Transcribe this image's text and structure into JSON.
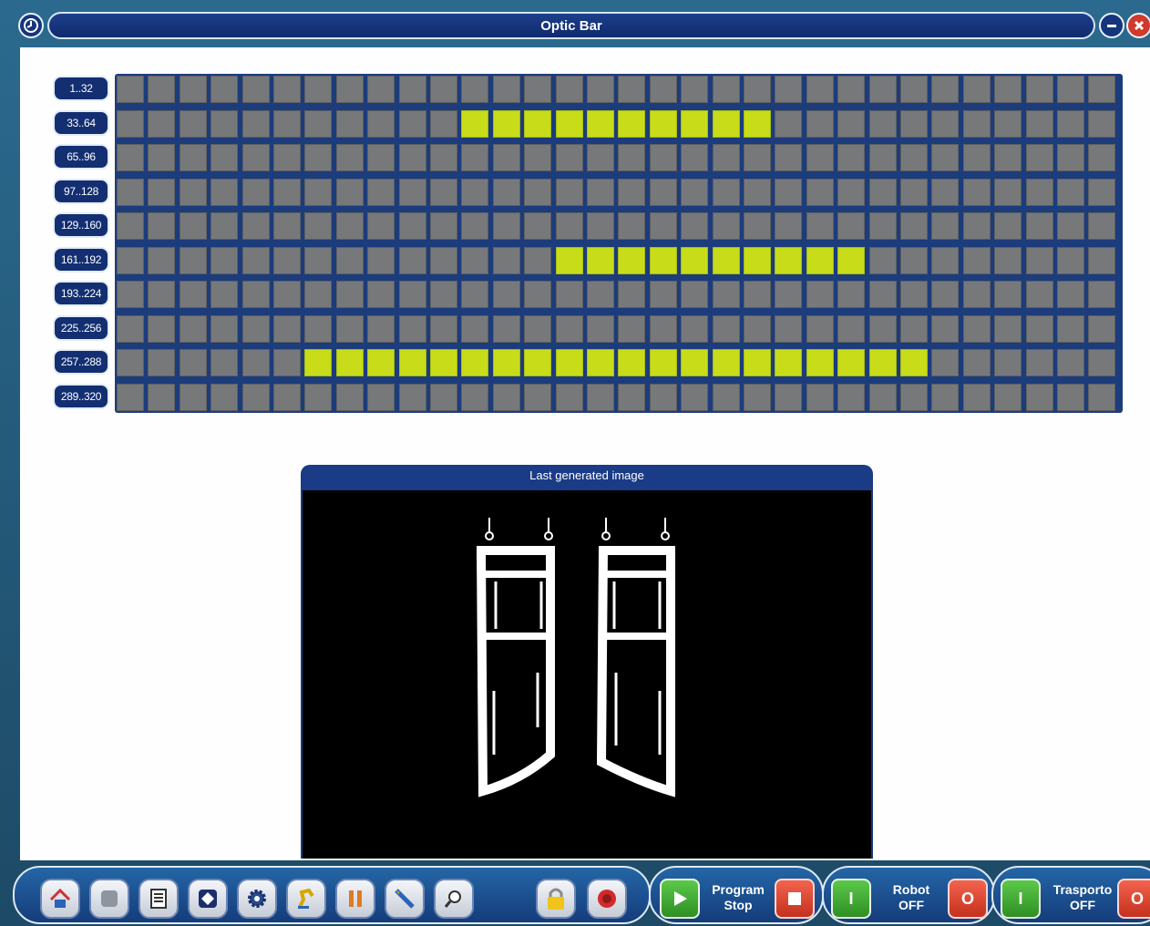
{
  "window": {
    "title": "Optic Bar"
  },
  "optic_bar": {
    "rows": [
      {
        "label": "1..32",
        "active": []
      },
      {
        "label": "33..64",
        "active": [
          11,
          12,
          13,
          14,
          15,
          16,
          17,
          18,
          19,
          20
        ]
      },
      {
        "label": "65..96",
        "active": []
      },
      {
        "label": "97..128",
        "active": []
      },
      {
        "label": "129..160",
        "active": []
      },
      {
        "label": "161..192",
        "active": [
          14,
          15,
          16,
          17,
          18,
          19,
          20,
          21,
          22,
          23
        ]
      },
      {
        "label": "193..224",
        "active": []
      },
      {
        "label": "225..256",
        "active": []
      },
      {
        "label": "257..288",
        "active": [
          6,
          7,
          8,
          9,
          10,
          11,
          12,
          13,
          14,
          15,
          16,
          17,
          18,
          19,
          20,
          21,
          22,
          23,
          24,
          25
        ]
      },
      {
        "label": "289..320",
        "active": []
      }
    ],
    "cells_per_row": 32,
    "active_color": "#c8dc19",
    "inactive_color": "#77787a"
  },
  "image_panel": {
    "title": "Last generated image"
  },
  "toolbar": {
    "left_icons": [
      "home-icon",
      "blank-icon",
      "list-icon",
      "diamond-icon",
      "gear-icon",
      "robot-arm-icon",
      "columns-icon",
      "pen-icon",
      "magnifier-icon"
    ],
    "lock_icon": "padlock-icon",
    "stop_icon": "record-stop-icon",
    "program": {
      "line1": "Program",
      "line2": "Stop"
    },
    "robot": {
      "line1": "Robot",
      "line2": "OFF",
      "on_symbol": "I",
      "off_symbol": "O"
    },
    "transport": {
      "line1": "Trasporto",
      "line2": "OFF",
      "on_symbol": "I",
      "off_symbol": "O"
    }
  }
}
